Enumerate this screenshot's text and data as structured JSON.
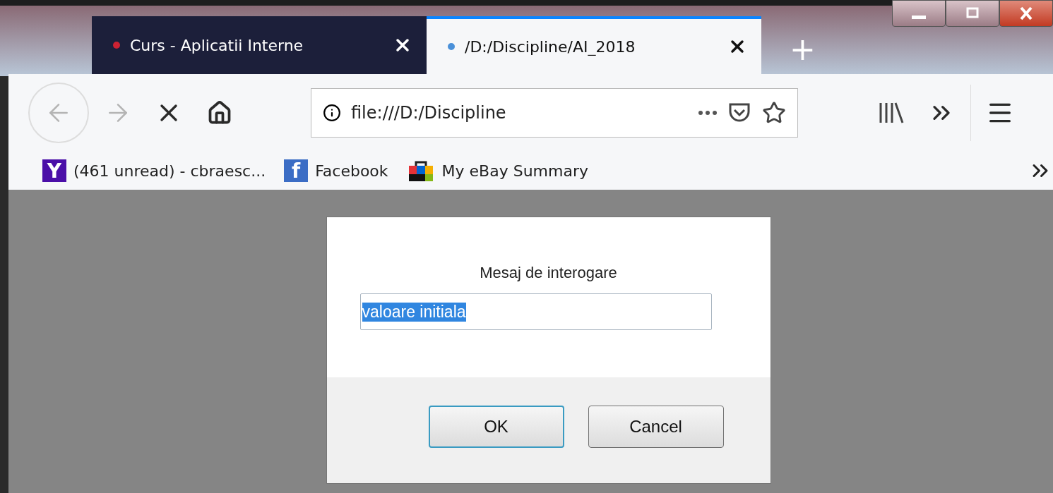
{
  "window": {
    "controls": [
      {
        "kind": "minimize"
      },
      {
        "kind": "maximize"
      },
      {
        "kind": "close"
      }
    ]
  },
  "tabs": [
    {
      "title": "Curs - Aplicatii Interne",
      "selected": false,
      "color": "#cc2233"
    },
    {
      "title": "/D:/Discipline/AI_2018",
      "selected": true,
      "color": "#4a90d9"
    }
  ],
  "new_tab": "+",
  "toolbar": {
    "back": {
      "disabled": true
    },
    "forward": {
      "disabled": true
    },
    "address": "file:///D:/Discipline"
  },
  "bookmarks": [
    {
      "kind": "yahoo",
      "logo": "Y",
      "label": "(461 unread) - cbraesc..."
    },
    {
      "kind": "facebook",
      "logo": "f",
      "label": "Facebook"
    },
    {
      "kind": "ebay",
      "label": "My eBay Summary"
    }
  ],
  "dialog": {
    "message": "Mesaj de interogare",
    "value": "valoare initiala",
    "value_selected": true,
    "buttons": [
      {
        "label": "OK",
        "selected": true
      },
      {
        "label": "Cancel",
        "selected": false
      }
    ]
  }
}
